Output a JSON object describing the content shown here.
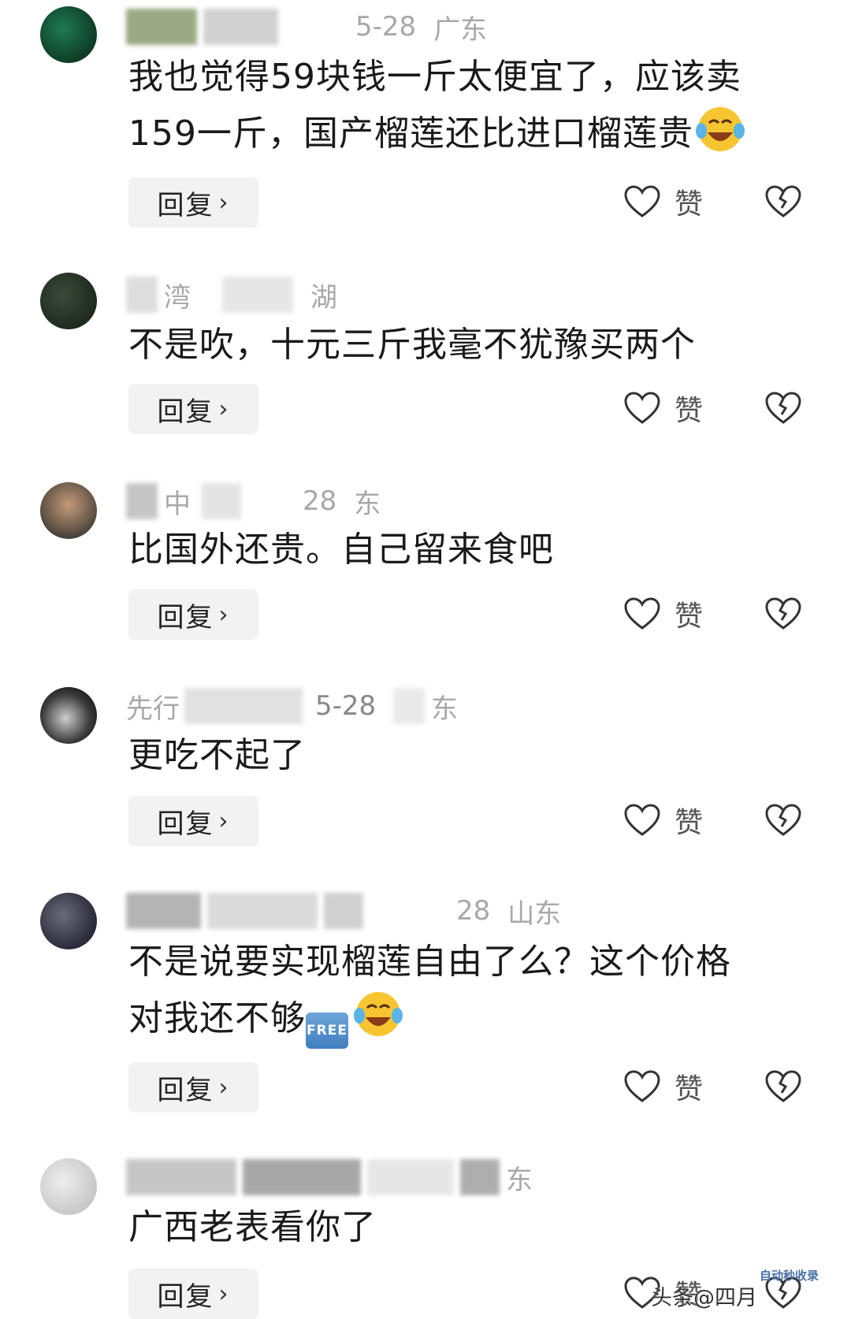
{
  "comments": [
    {
      "meta_date": "5-28",
      "meta_location": "广东",
      "text": "我也觉得59块钱一斤太便宜了，应该卖159一斤，国产榴莲还比进口榴莲贵",
      "emoji": [
        "laughing-crying-emoji"
      ],
      "reply_label": "回复",
      "like_label": "赞"
    },
    {
      "meta_name": "湾",
      "meta_location": "湖",
      "text": "不是吹，十元三斤我毫不犹豫买两个",
      "reply_label": "回复",
      "like_label": "赞"
    },
    {
      "meta_name": "中",
      "meta_date": "28",
      "meta_location": "东",
      "text": "比国外还贵。自己留来食吧",
      "reply_label": "回复",
      "like_label": "赞"
    },
    {
      "meta_name": "先行",
      "meta_date": "5-28",
      "meta_location": "东",
      "text": "更吃不起了",
      "reply_label": "回复",
      "like_label": "赞"
    },
    {
      "meta_date": "28",
      "meta_location": "山东",
      "text_line1": "不是说要实现榴莲自由了么？这个价格",
      "text_line2": "对我还不够",
      "free_badge": "FREE",
      "emoji": [
        "laughing-crying-emoji"
      ],
      "reply_label": "回复",
      "like_label": "赞"
    },
    {
      "meta_location": "东",
      "text": "广西老表看你了",
      "reply_label": "回复",
      "like_label": "赞"
    }
  ],
  "watermark": {
    "text": "头条@四月",
    "logo_text": "自动秒收录"
  },
  "colors": {
    "reply_bg": "#f2f2f2",
    "meta_text": "#a8a8a8",
    "main_text": "#1a1a1a"
  }
}
